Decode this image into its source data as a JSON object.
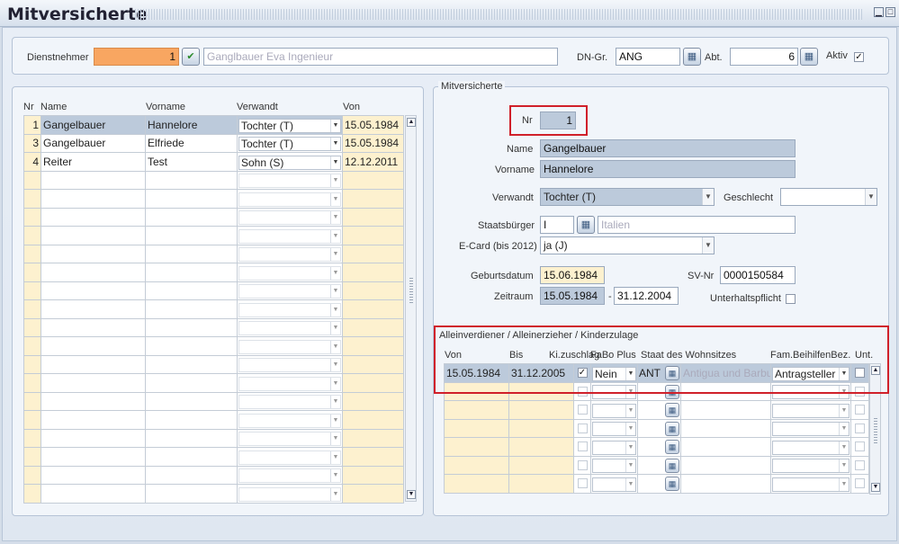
{
  "window": {
    "title": "Mitversicherte"
  },
  "header": {
    "dienstnehmer_label": "Dienstnehmer",
    "dienstnehmer_nr": "1",
    "dienstnehmer_name": "Ganglbauer Eva Ingenieur",
    "dngr_label": "DN-Gr.",
    "dngr_value": "ANG",
    "abt_label": "Abt.",
    "abt_value": "6",
    "aktiv_label": "Aktiv",
    "aktiv_checked": true
  },
  "list": {
    "columns": {
      "nr": "Nr",
      "name": "Name",
      "vorname": "Vorname",
      "verwandt": "Verwandt",
      "von": "Von"
    },
    "rows": [
      {
        "nr": "1",
        "name": "Gangelbauer",
        "vorname": "Hannelore",
        "verwandt": "Tochter (T)",
        "von": "15.05.1984"
      },
      {
        "nr": "3",
        "name": "Gangelbauer",
        "vorname": "Elfriede",
        "verwandt": "Tochter (T)",
        "von": "15.05.1984"
      },
      {
        "nr": "4",
        "name": "Reiter",
        "vorname": "Test",
        "verwandt": "Sohn (S)",
        "von": "12.12.2011"
      }
    ]
  },
  "detail": {
    "section_title": "Mitversicherte",
    "nr_label": "Nr",
    "nr_value": "1",
    "name_label": "Name",
    "name_value": "Gangelbauer",
    "vorname_label": "Vorname",
    "vorname_value": "Hannelore",
    "verwandt_label": "Verwandt",
    "verwandt_value": "Tochter (T)",
    "geschlecht_label": "Geschlecht",
    "geschlecht_value": "",
    "staatsbuerger_label": "Staatsbürger",
    "staatsbuerger_code": "I",
    "staatsbuerger_name": "Italien",
    "ecard_label": "E-Card (bis 2012)",
    "ecard_value": "ja (J)",
    "geburtsdatum_label": "Geburtsdatum",
    "geburtsdatum_value": "15.06.1984",
    "svnr_label": "SV-Nr",
    "svnr_value": "0000150584",
    "zeitraum_label": "Zeitraum",
    "zeitraum_from": "15.05.1984",
    "zeitraum_sep": "-",
    "zeitraum_to": "31.12.2004",
    "unterhalt_label": "Unterhaltspflicht",
    "unterhalt_checked": false
  },
  "allein": {
    "section_title": "Alleinverdiener / Alleinerzieher / Kinderzulage",
    "columns": {
      "von": "Von",
      "bis": "Bis",
      "ki": "Ki.zuschlag",
      "fabo": "FaBo Plus",
      "staat": "Staat des Wohnsitzes",
      "fam": "Fam.BeihilfenBez.",
      "unt": "Unt."
    },
    "row": {
      "von": "15.05.1984",
      "bis": "31.12.2005",
      "ki_checked": true,
      "fabo": "Nein",
      "staat_code": "ANT",
      "staat_name": "Antigua und Barbuda",
      "fam": "Antragsteller",
      "unt_checked": false
    }
  },
  "colors": {
    "accent_orange": "#f8a661",
    "highlight_red": "#d0202a",
    "selected_row": "#bccadb",
    "date_yellow": "#fdf1cf"
  }
}
